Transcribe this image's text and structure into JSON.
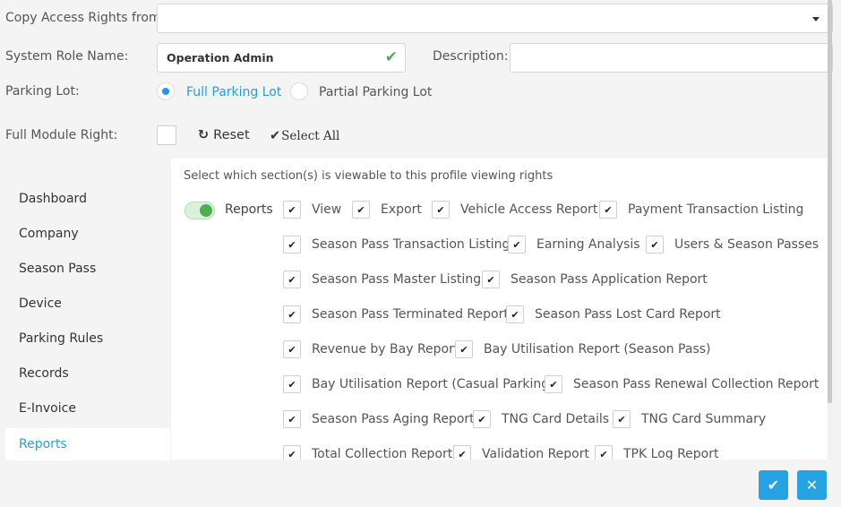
{
  "form": {
    "copy_access_label": "Copy Access Rights from:",
    "copy_access_value": "",
    "system_role_label": "System Role Name:",
    "system_role_value": "Operation Admin",
    "description_label": "Description:",
    "description_value": "",
    "parking_lot_label": "Parking Lot:",
    "parking_options": [
      {
        "label": "Full Parking Lot",
        "selected": true
      },
      {
        "label": "Partial Parking Lot",
        "selected": false
      }
    ],
    "full_module_label": "Full Module Right:",
    "reset_label": "Reset",
    "select_all_label": "Select All"
  },
  "sidebar": {
    "items": [
      {
        "label": "Dashboard"
      },
      {
        "label": "Company"
      },
      {
        "label": "Season Pass"
      },
      {
        "label": "Device"
      },
      {
        "label": "Parking Rules"
      },
      {
        "label": "Records"
      },
      {
        "label": "E-Invoice"
      },
      {
        "label": "Reports",
        "active": true
      }
    ]
  },
  "panel": {
    "hint": "Select which section(s) is viewable to this profile viewing rights",
    "toggle_label": "Reports",
    "toggle_on": true,
    "rows": [
      [
        "View",
        "Export",
        "Vehicle Access Report",
        "Payment Transaction Listing"
      ],
      [
        "Season Pass Transaction Listing",
        "Earning Analysis",
        "Users & Season Passes"
      ],
      [
        "Season Pass Master Listing",
        "Season Pass Application Report"
      ],
      [
        "Season Pass Terminated Report",
        "Season Pass Lost Card Report"
      ],
      [
        "Revenue by Bay Report",
        "Bay Utilisation Report (Season Pass)"
      ],
      [
        "Bay Utilisation Report (Casual Parking)",
        "Season Pass Renewal Collection Report"
      ],
      [
        "Season Pass Aging Report",
        "TNG Card Details",
        "TNG Card Summary"
      ],
      [
        "Total Collection Report",
        "Validation Report",
        "TPK Log Report"
      ]
    ],
    "check_glyph": "✔"
  },
  "actions": {
    "confirm_glyph": "✔",
    "cancel_glyph": "✕"
  },
  "colors": {
    "accent": "#26a3e3",
    "active_text": "#2a9de0",
    "valid": "#4caf50"
  }
}
